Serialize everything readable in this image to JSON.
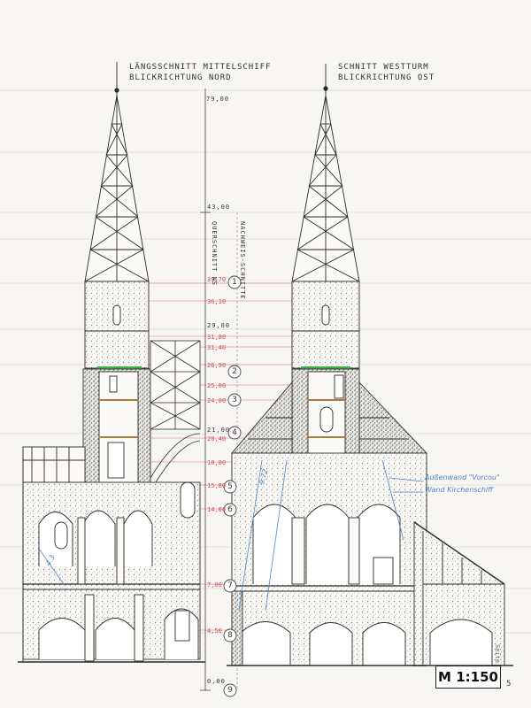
{
  "titles": {
    "left_line1": "LÄNGSSCHNITT MITTELSCHIFF",
    "left_line2": "BLICKRICHTUNG NORD",
    "right_line1": "SCHNITT WESTTURM",
    "right_line2": "BLICKRICHTUNG OST"
  },
  "top_elevation": "79,00",
  "axis_labels": {
    "querschnitt": "QUERSCHNITT NS",
    "machweise": "NACHWEIS-SCHNITTE"
  },
  "red_elevations": [
    "39,70",
    "36,10",
    "31,80",
    "31,40",
    "26,90",
    "25,00",
    "24,00",
    "20,40",
    "18,80",
    "15,80",
    "14,00",
    "7,00",
    "4,50"
  ],
  "black_elevations": [
    "43,00",
    "29,00",
    "21,00",
    "0,00"
  ],
  "section_markers": [
    "1",
    "2",
    "3",
    "4",
    "5",
    "6",
    "7",
    "8",
    "9"
  ],
  "annotations": {
    "blue_note_1": "Außenwand \"Vorcou\"",
    "blue_note_2": "Wand Kirchenschiff",
    "left_dim": "4.3",
    "right_dim": "9.72"
  },
  "scale": "M 1:150",
  "page_number": "5",
  "side_note": "Seite",
  "colors": {
    "ink": "#2b2b2b",
    "red_lines": "#e06a74",
    "blue_lines": "#4f86c6",
    "green_band": "#3bb24a",
    "paper": "#f7f6f2"
  }
}
